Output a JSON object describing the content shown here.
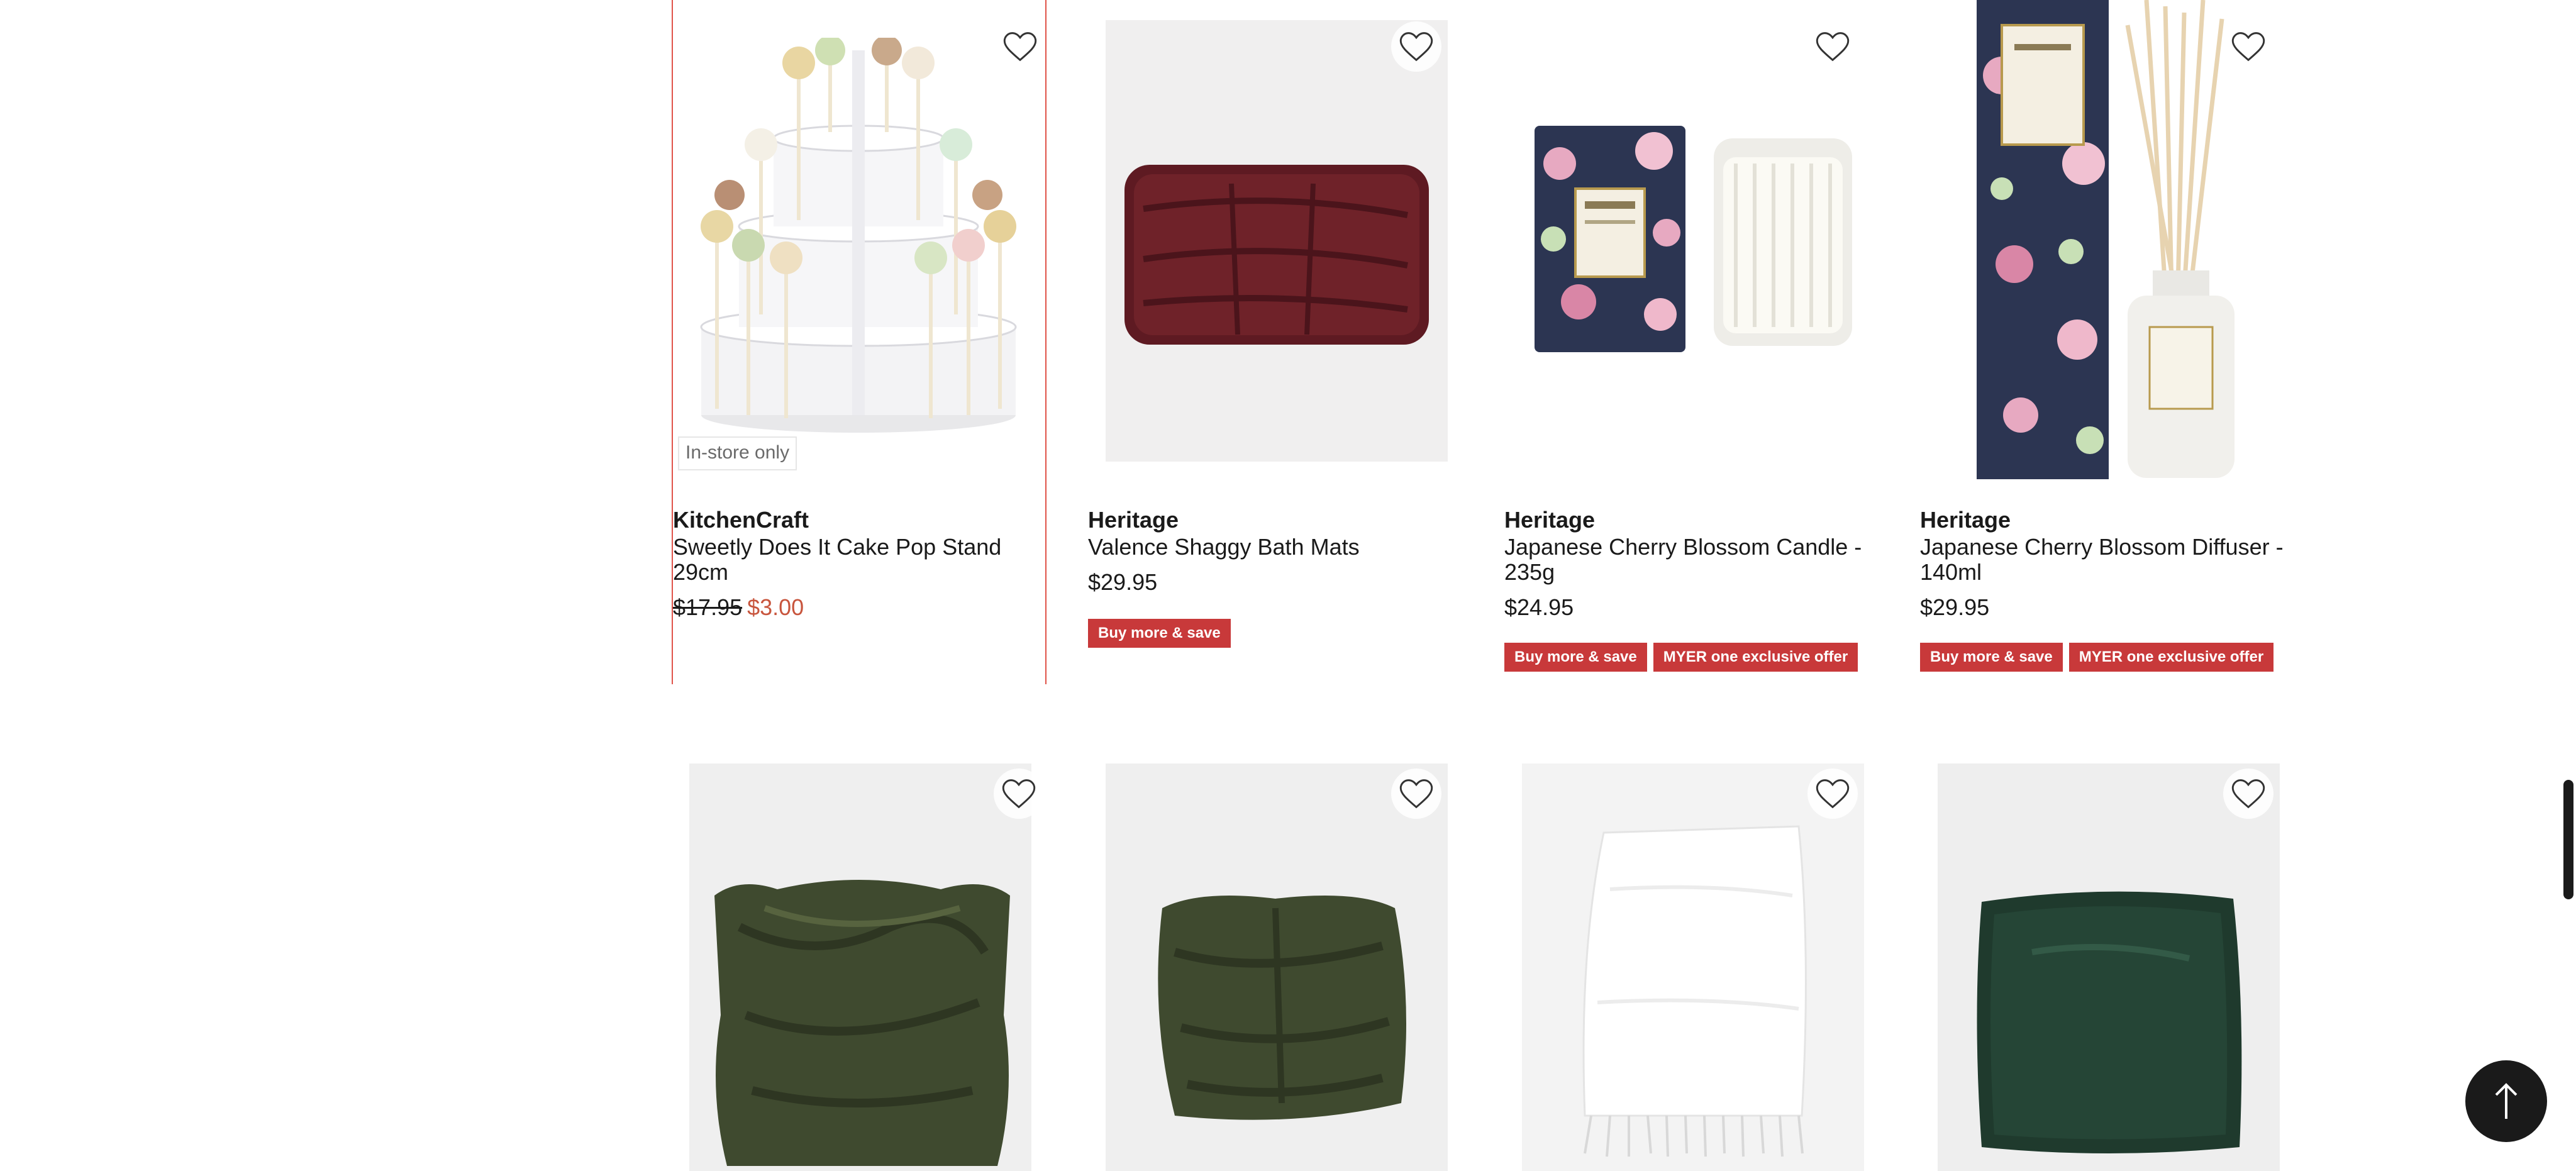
{
  "colors": {
    "accent_red": "#c8393a",
    "sale_price": "#c8553d",
    "highlight_border": "#e0544a",
    "back_to_top_bg": "#1a1a1a"
  },
  "icons": {
    "wishlist": "heart-outline-icon",
    "back_to_top": "arrow-up-icon"
  },
  "products": [
    {
      "brand": "KitchenCraft",
      "title": "Sweetly Does It Cake Pop Stand 29cm",
      "price_was": "$17.95",
      "price_now": "$3.00",
      "tag": "In-store only",
      "badges": []
    },
    {
      "brand": "Heritage",
      "title": "Valence Shaggy Bath Mats",
      "price": "$29.95",
      "badges": [
        "Buy more & save"
      ]
    },
    {
      "brand": "Heritage",
      "title": "Japanese Cherry Blossom Candle - 235g",
      "price": "$24.95",
      "badges": [
        "Buy more & save",
        "MYER one exclusive offer"
      ]
    },
    {
      "brand": "Heritage",
      "title": "Japanese Cherry Blossom Diffuser - 140ml",
      "price": "$29.95",
      "badges": [
        "Buy more & save",
        "MYER one exclusive offer"
      ]
    },
    {
      "image": "green faux fur cushion"
    },
    {
      "image": "green faux fur square cushion"
    },
    {
      "image": "white tasselled throw"
    },
    {
      "image": "green velvet cushion"
    }
  ]
}
